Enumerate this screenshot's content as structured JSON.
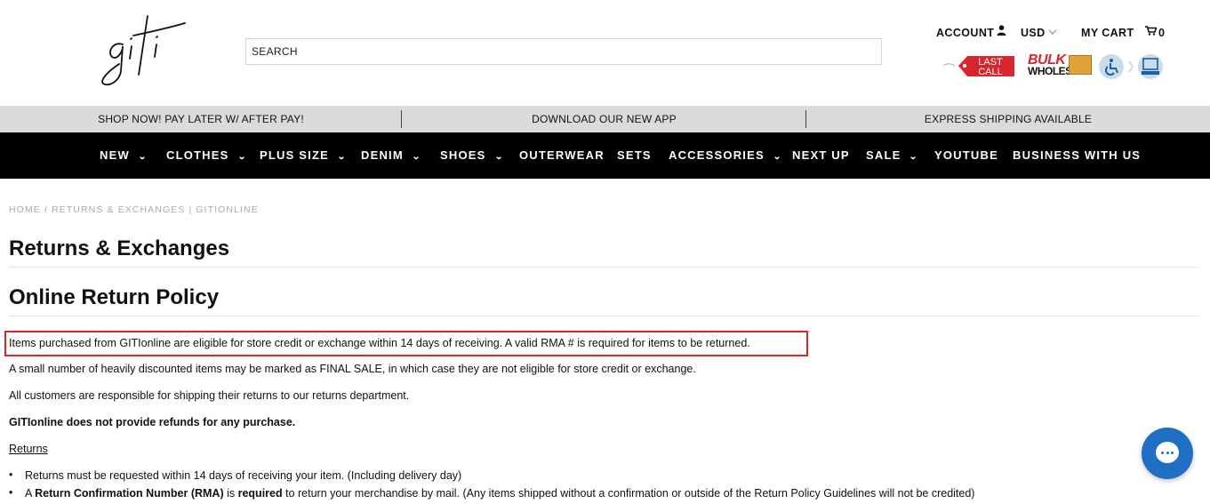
{
  "header": {
    "logo_text": "giti",
    "search_placeholder": "SEARCH",
    "account_label": "ACCOUNT",
    "currency": "USD",
    "cart_label": "MY CART",
    "cart_count": "0",
    "badge_last_call": "LAST CALL",
    "badge_bulk_line1": "BULK",
    "badge_bulk_line2": "WHOLESALE"
  },
  "promo": {
    "items": [
      "SHOP NOW! PAY LATER W/ AFTER PAY!",
      "DOWNLOAD OUR NEW APP",
      "EXPRESS SHIPPING AVAILABLE"
    ]
  },
  "nav": {
    "items": [
      {
        "label": "NEW",
        "dropdown": true
      },
      {
        "label": "CLOTHES",
        "dropdown": true
      },
      {
        "label": "PLUS SIZE",
        "dropdown": true
      },
      {
        "label": "DENIM",
        "dropdown": true
      },
      {
        "label": "SHOES",
        "dropdown": true
      },
      {
        "label": "OUTERWEAR",
        "dropdown": false
      },
      {
        "label": "SETS",
        "dropdown": false
      },
      {
        "label": "ACCESSORIES",
        "dropdown": true
      },
      {
        "label": "NEXT UP",
        "dropdown": false
      },
      {
        "label": "SALE",
        "dropdown": true
      },
      {
        "label": "YOUTUBE",
        "dropdown": false
      },
      {
        "label": "BUSINESS WITH US",
        "dropdown": false
      }
    ]
  },
  "breadcrumb": {
    "home": "HOME",
    "separator": "/",
    "current": "RETURNS & EXCHANGES | GITIONLINE"
  },
  "content": {
    "title": "Returns & Exchanges",
    "subtitle": "Online Return Policy",
    "p1": "Items purchased from GITIonline are eligible for store credit or exchange within 14 days of receiving. A valid RMA # is required for items to be returned.",
    "p2": "A small number of heavily discounted items may be marked as FINAL SALE, in which case they are not eligible for store credit or exchange.",
    "p3": "All customers are responsible for shipping their returns to our returns department.",
    "p4": "GITIonline does not provide refunds for any purchase.",
    "returns_heading": "Returns",
    "bullet1": "Returns must be requested within 14 days of receiving your item. (Including delivery day)",
    "bullet2_a": "A ",
    "bullet2_b": "Return Confirmation Number (RMA)",
    "bullet2_c": " is ",
    "bullet2_d": "required",
    "bullet2_e": " to return your merchandise by mail. (Any items shipped without a confirmation or outside of the Return Policy Guidelines will not be credited)"
  },
  "colors": {
    "nav_bg": "#000000",
    "promo_bg": "#d9dbdc",
    "highlight": "#d9262e",
    "chat": "#1f6fc5"
  }
}
